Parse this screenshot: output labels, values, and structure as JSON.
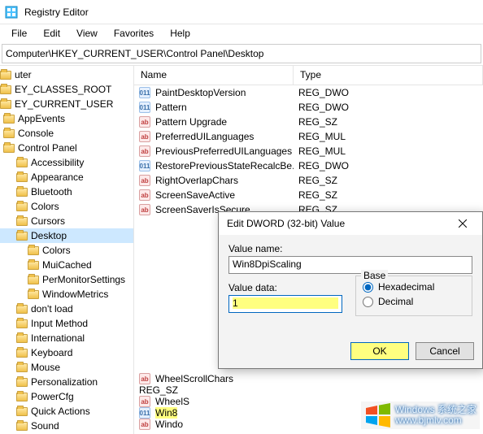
{
  "title": "Registry Editor",
  "menu": [
    "File",
    "Edit",
    "View",
    "Favorites",
    "Help"
  ],
  "address": "Computer\\HKEY_CURRENT_USER\\Control Panel\\Desktop",
  "tree": [
    {
      "label": "uter",
      "level": 0,
      "selected": false
    },
    {
      "label": "EY_CLASSES_ROOT",
      "level": 1,
      "selected": false
    },
    {
      "label": "EY_CURRENT_USER",
      "level": 1,
      "selected": false
    },
    {
      "label": "AppEvents",
      "level": 2,
      "selected": false
    },
    {
      "label": "Console",
      "level": 2,
      "selected": false
    },
    {
      "label": "Control Panel",
      "level": 2,
      "selected": false
    },
    {
      "label": "Accessibility",
      "level": 3,
      "selected": false
    },
    {
      "label": "Appearance",
      "level": 3,
      "selected": false
    },
    {
      "label": "Bluetooth",
      "level": 3,
      "selected": false
    },
    {
      "label": "Colors",
      "level": 3,
      "selected": false
    },
    {
      "label": "Cursors",
      "level": 3,
      "selected": false
    },
    {
      "label": "Desktop",
      "level": 3,
      "selected": true
    },
    {
      "label": "Colors",
      "level": 3,
      "selected": false,
      "child": true
    },
    {
      "label": "MuiCached",
      "level": 3,
      "selected": false,
      "child": true
    },
    {
      "label": "PerMonitorSettings",
      "level": 3,
      "selected": false,
      "child": true
    },
    {
      "label": "WindowMetrics",
      "level": 3,
      "selected": false,
      "child": true
    },
    {
      "label": "don't load",
      "level": 3,
      "selected": false
    },
    {
      "label": "Input Method",
      "level": 3,
      "selected": false
    },
    {
      "label": "International",
      "level": 3,
      "selected": false
    },
    {
      "label": "Keyboard",
      "level": 3,
      "selected": false
    },
    {
      "label": "Mouse",
      "level": 3,
      "selected": false
    },
    {
      "label": "Personalization",
      "level": 3,
      "selected": false
    },
    {
      "label": "PowerCfg",
      "level": 3,
      "selected": false
    },
    {
      "label": "Quick Actions",
      "level": 3,
      "selected": false
    },
    {
      "label": "Sound",
      "level": 3,
      "selected": false
    }
  ],
  "columns": {
    "name": "Name",
    "type": "Type"
  },
  "values": [
    {
      "icon": "n",
      "name": "PaintDesktopVersion",
      "type": "REG_DWO"
    },
    {
      "icon": "n",
      "name": "Pattern",
      "type": "REG_DWO"
    },
    {
      "icon": "ab",
      "name": "Pattern Upgrade",
      "type": "REG_SZ"
    },
    {
      "icon": "ab",
      "name": "PreferredUILanguages",
      "type": "REG_MUL"
    },
    {
      "icon": "ab",
      "name": "PreviousPreferredUILanguages",
      "type": "REG_MUL"
    },
    {
      "icon": "n",
      "name": "RestorePreviousStateRecalcBe...",
      "type": "REG_DWO"
    },
    {
      "icon": "ab",
      "name": "RightOverlapChars",
      "type": "REG_SZ"
    },
    {
      "icon": "ab",
      "name": "ScreenSaveActive",
      "type": "REG_SZ"
    },
    {
      "icon": "ab",
      "name": "ScreenSaverIsSecure",
      "type": "REG_SZ"
    }
  ],
  "values_after_dialog": [
    {
      "icon": "ab",
      "name": "WheelScrollChars",
      "type": "REG_SZ",
      "hl": false
    },
    {
      "icon": "ab",
      "name": "WheelS",
      "type": "",
      "hl": false
    },
    {
      "icon": "n",
      "name": "Win8",
      "type": "",
      "hl": true
    },
    {
      "icon": "ab",
      "name": "Windo",
      "type": "",
      "hl": false
    }
  ],
  "dialog": {
    "title": "Edit DWORD (32-bit) Value",
    "value_name_label": "Value name:",
    "value_name": "Win8DpiScaling",
    "value_data_label": "Value data:",
    "value_data": "1",
    "base_label": "Base",
    "hex_label": "Hexadecimal",
    "dec_label": "Decimal",
    "base_selected": "hex",
    "ok_label": "OK",
    "cancel_label": "Cancel"
  },
  "watermark": {
    "line1": "Windows 系统之家",
    "line2": "www.bjmlv.com"
  }
}
